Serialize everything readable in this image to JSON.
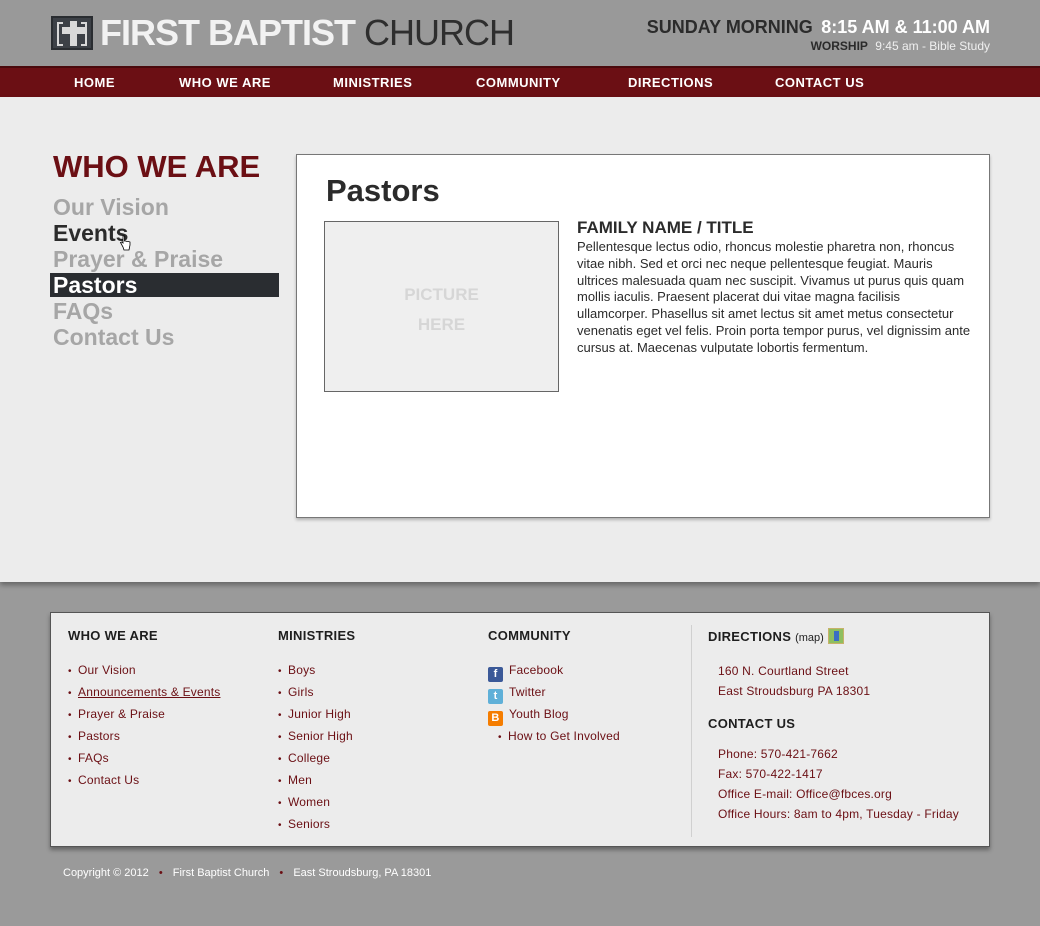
{
  "header": {
    "logo_bold": "FIRST BAPTIST",
    "logo_light": "CHURCH",
    "service_label": "SUNDAY MORNING",
    "service_times": "8:15 AM & 11:00 AM",
    "worship_label": "WORSHIP",
    "bible_study": "9:45 am - Bible Study"
  },
  "nav": {
    "items": [
      "HOME",
      "WHO WE ARE",
      "MINISTRIES",
      "COMMUNITY",
      "DIRECTIONS",
      "CONTACT US"
    ]
  },
  "sidebar": {
    "title": "WHO WE ARE",
    "items": [
      "Our Vision",
      "Events",
      "Prayer & Praise",
      "Pastors",
      "FAQs",
      "Contact Us"
    ],
    "active": "Pastors"
  },
  "content": {
    "heading": "Pastors",
    "picture_line1": "PICTURE",
    "picture_line2": "HERE",
    "bio_title": "FAMILY NAME / TITLE",
    "bio_text": "Pellentesque lectus odio, rhoncus molestie pharetra non, rhoncus vitae nibh. Sed et orci nec neque pellentesque feugiat. Mauris ultrices malesuada quam nec suscipit. Vivamus ut purus quis quam mollis iaculis. Praesent placerat dui vitae magna facilisis ullamcorper. Phasellus sit amet lectus sit amet metus consectetur venenatis eget vel felis. Proin porta tempor purus, vel dignissim ante cursus at. Maecenas vulputate lobortis fermentum."
  },
  "footer": {
    "who_we_are": {
      "title": "WHO WE ARE",
      "items": [
        "Our Vision",
        "Announcements & Events",
        "Prayer & Praise",
        "Pastors",
        "FAQs",
        "Contact Us"
      ]
    },
    "ministries": {
      "title": "MINISTRIES",
      "items": [
        "Boys",
        "Girls",
        "Junior High",
        "Senior High",
        "College",
        "Men",
        "Women",
        "Seniors"
      ]
    },
    "community": {
      "title": "COMMUNITY",
      "facebook": "Facebook",
      "twitter": "Twitter",
      "youth_blog": "Youth Blog",
      "get_involved": "How to Get Involved"
    },
    "directions": {
      "title": "DIRECTIONS",
      "map_label": "(map)",
      "street": "160 N. Courtland Street",
      "city": "East Stroudsburg PA 18301"
    },
    "contact": {
      "title": "CONTACT US",
      "phone": "Phone: 570-421-7662",
      "fax": "Fax: 570-422-1417",
      "email": "Office E-mail: Office@fbces.org",
      "hours": "Office Hours: 8am to 4pm, Tuesday - Friday"
    },
    "copyright": "Copyright © 2012",
    "church_name": "First Baptist Church",
    "location": "East Stroudsburg, PA 18301"
  },
  "colors": {
    "brand": "#6b0f14",
    "dark": "#2a2d31",
    "header_bg": "#999999",
    "content_bg": "#ececec"
  }
}
